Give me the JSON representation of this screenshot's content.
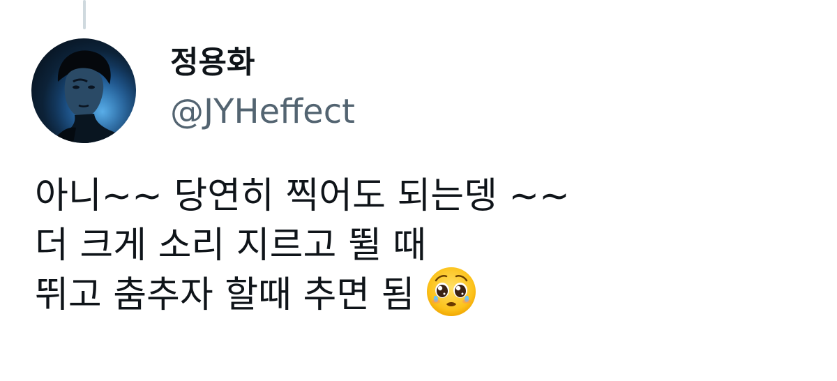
{
  "tweet": {
    "display_name": "정용화",
    "handle": "@JYHeffect",
    "lines": [
      "아니~~ 당연히 찍어도 되는뎅 ~~",
      "더 크게 소리 지르고 뛸 때",
      "뛰고 춤추자 할때 추면 됨"
    ],
    "emoji": "pleading-face-icon"
  },
  "colors": {
    "text": "#0f1419",
    "secondary_text": "#536471",
    "thread_line": "#cfd9de"
  }
}
